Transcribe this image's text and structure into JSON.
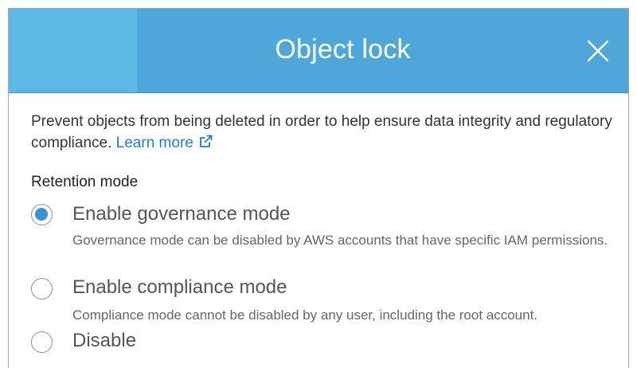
{
  "dialog": {
    "title": "Object lock",
    "close_icon": "close-icon",
    "description": "Prevent objects from being deleted in order to help ensure data integrity and regulatory compliance.",
    "learn_more": "Learn more",
    "external_link_icon": "external-link-icon",
    "retention_label": "Retention mode",
    "options": [
      {
        "label": "Enable governance mode",
        "description": "Governance mode can be disabled by AWS accounts that have specific IAM permissions.",
        "selected": true
      },
      {
        "label": "Enable compliance mode",
        "description": "Compliance mode cannot be disabled by any user, including the root account.",
        "selected": false
      },
      {
        "label": "Disable",
        "description": "",
        "selected": false
      }
    ]
  },
  "colors": {
    "header": "#4ea7d8",
    "header_accent": "#5cb8e4",
    "link": "#1f7fc5",
    "radio_selected": "#3b92d4"
  }
}
